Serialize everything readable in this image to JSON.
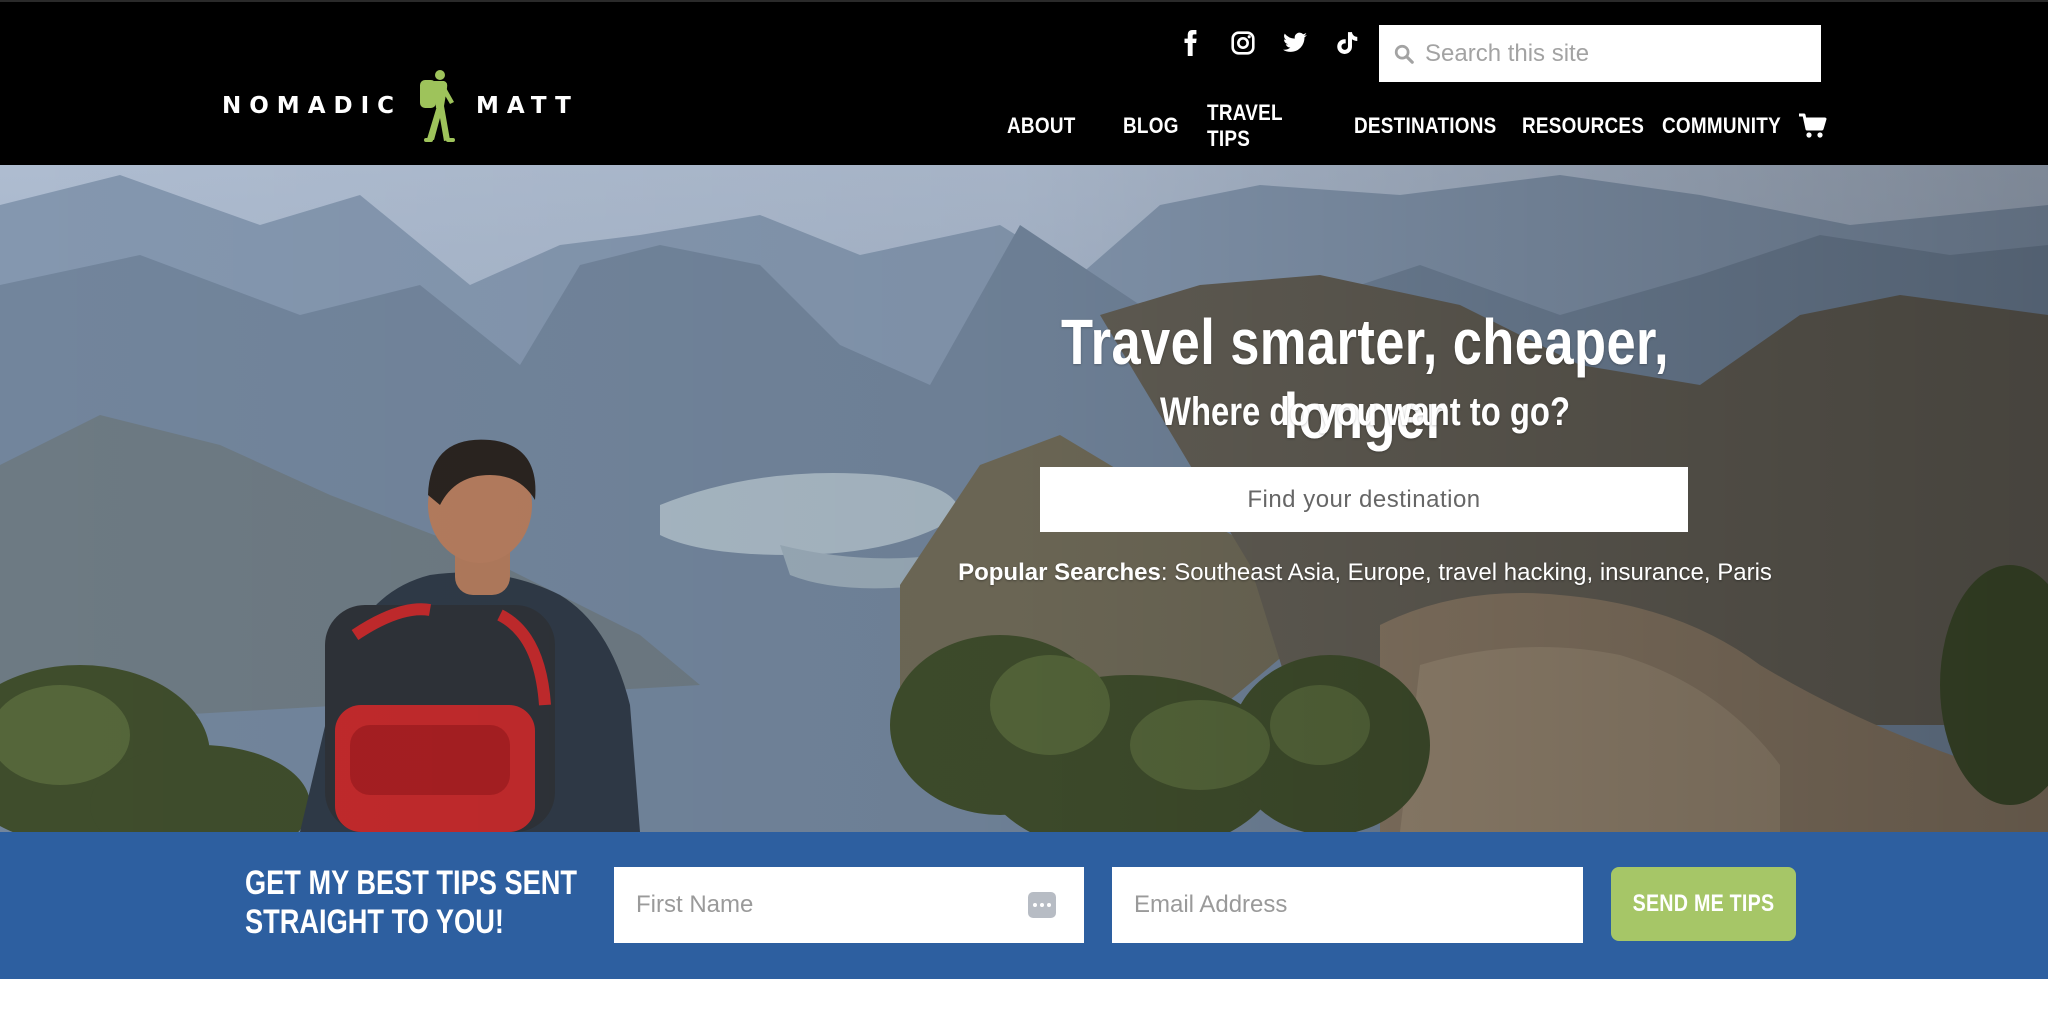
{
  "brand": {
    "logo_left": "NOMADIC",
    "logo_right": "MATT",
    "logo_color": "#9ec35b"
  },
  "header": {
    "social": [
      {
        "icon": "facebook-icon"
      },
      {
        "icon": "instagram-icon"
      },
      {
        "icon": "twitter-icon"
      },
      {
        "icon": "tiktok-icon"
      }
    ],
    "search_placeholder": "Search this site",
    "nav": {
      "about": "ABOUT",
      "blog": "BLOG",
      "travel_tips": "TRAVEL TIPS",
      "destinations": "DESTINATIONS",
      "resources": "RESOURCES",
      "community": "COMMUNITY"
    },
    "cart_icon": "cart-icon"
  },
  "hero": {
    "title": "Travel smarter, cheaper, longer",
    "subtitle": "Where do you want to go?",
    "destination_placeholder": "Find your destination",
    "popular_label": "Popular Searches",
    "popular_items": [
      "Southeast Asia",
      "Europe",
      "travel hacking",
      "insurance",
      "Paris"
    ]
  },
  "signup": {
    "heading_line1": "GET MY BEST TIPS SENT",
    "heading_line2": "STRAIGHT TO YOU!",
    "first_name_placeholder": "First Name",
    "email_placeholder": "Email Address",
    "button_label": "SEND ME TIPS",
    "bar_color": "#2d5fa0",
    "button_color": "#a6c667"
  }
}
